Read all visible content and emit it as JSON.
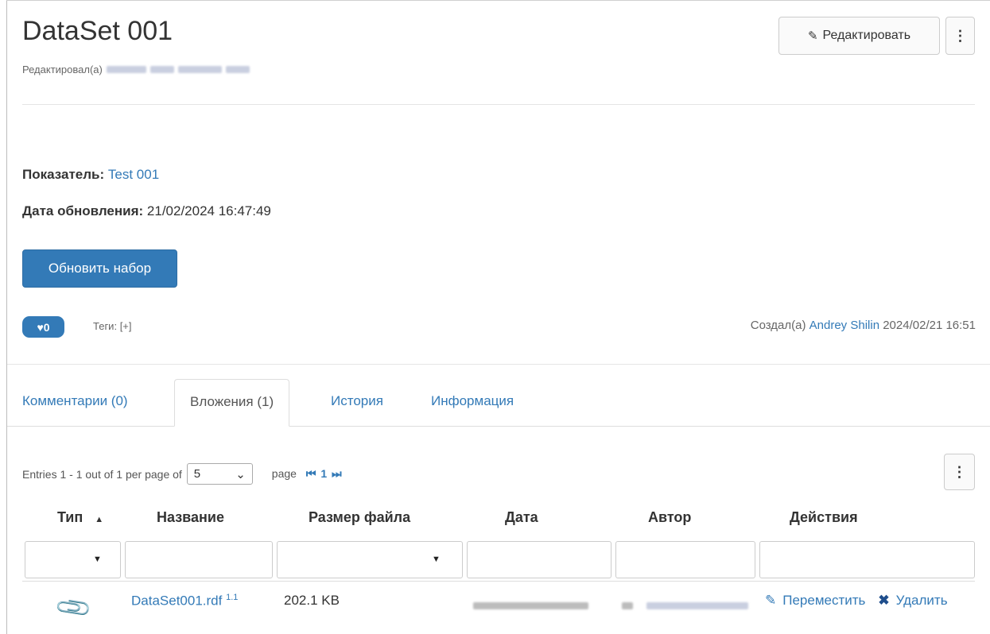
{
  "header": {
    "title": "DataSet 001",
    "edited_label": "Редактировал(а)",
    "edit_button": "Редактировать",
    "more_button": "⋮"
  },
  "fields": {
    "indicator_label": "Показатель:",
    "indicator_value": "Test 001",
    "updated_label": "Дата обновления:",
    "updated_value": "21/02/2024 16:47:49"
  },
  "refresh_button": "Обновить набор",
  "likes": {
    "count": "0"
  },
  "tags": {
    "label": "Теги:",
    "add": "[+]"
  },
  "created": {
    "label": "Создал(а)",
    "author": "Andrey Shilin",
    "date": "2024/02/21 16:51"
  },
  "tabs": [
    {
      "label": "Комментарии (0)"
    },
    {
      "label": "Вложения (1)"
    },
    {
      "label": "История"
    },
    {
      "label": "Информация"
    }
  ],
  "pagination": {
    "entries_text": "Entries 1 - 1 out of 1 per page of",
    "per_page": "5",
    "page_label": "page",
    "first": "⏮",
    "current": "1",
    "last": "⏭"
  },
  "table": {
    "headers": [
      "Тип",
      "Название",
      "Размер файла",
      "Дата",
      "Автор",
      "Действия"
    ],
    "sort_indicator": "▲",
    "rows": [
      {
        "name": "DataSet001.rdf",
        "version": "1.1",
        "size": "202.1 KB",
        "move": "Переместить",
        "delete": "Удалить"
      }
    ]
  },
  "colors": {
    "primary": "#337ab7",
    "link": "#337ab7"
  },
  "icons": [
    "pencil-icon",
    "kebab-menu-icon",
    "heart-icon",
    "paperclip-icon",
    "edit-icon",
    "delete-icon"
  ]
}
